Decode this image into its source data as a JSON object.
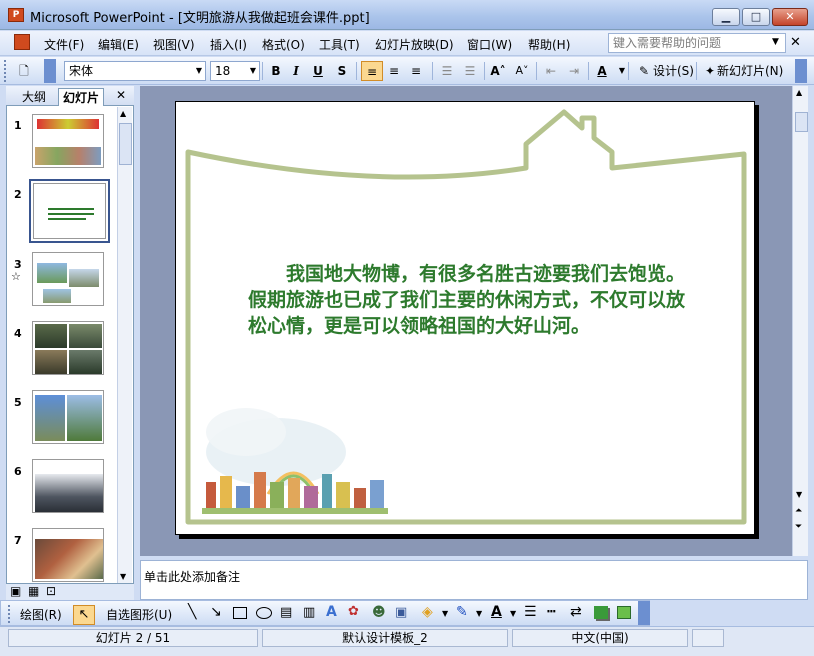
{
  "window": {
    "title": "Microsoft PowerPoint - [文明旅游从我做起班会课件.ppt]",
    "app_icon": "P",
    "minimize": "▁",
    "maximize": "□",
    "close": "✕"
  },
  "menubar": {
    "items": [
      "文件(F)",
      "编辑(E)",
      "视图(V)",
      "插入(I)",
      "格式(O)",
      "工具(T)",
      "幻灯片放映(D)",
      "窗口(W)",
      "帮助(H)"
    ],
    "help_placeholder": "键入需要帮助的问题",
    "close": "✕"
  },
  "format_toolbar": {
    "font": "宋体",
    "size": "18",
    "bold": "B",
    "italic": "I",
    "underline": "U",
    "shadow": "S",
    "design_label": "设计(S)",
    "new_slide_label": "新幻灯片(N)"
  },
  "left_panel": {
    "tab_outline": "大纲",
    "tab_slides": "幻灯片",
    "close": "✕",
    "slides": [
      "1",
      "2",
      "3",
      "4",
      "5",
      "6",
      "7"
    ],
    "slide3_star": "☆"
  },
  "slide": {
    "body_text": "我国地大物博，有很多名胜古迹要我们去饱览。假期旅游也已成了我们主要的休闲方式，不仅可以放松心情，更是可以领略祖国的大好山河。"
  },
  "notes": {
    "placeholder": "单击此处添加备注"
  },
  "draw_toolbar": {
    "draw_label": "绘图(R)",
    "autoshape_label": "自选图形(U)"
  },
  "statusbar": {
    "slide_index": "幻灯片 2 / 51",
    "template": "默认设计模板_2",
    "language": "中文(中国)"
  },
  "colors": {
    "slide_text": "#2d7a2d",
    "frame_green": "#a8b87a"
  }
}
